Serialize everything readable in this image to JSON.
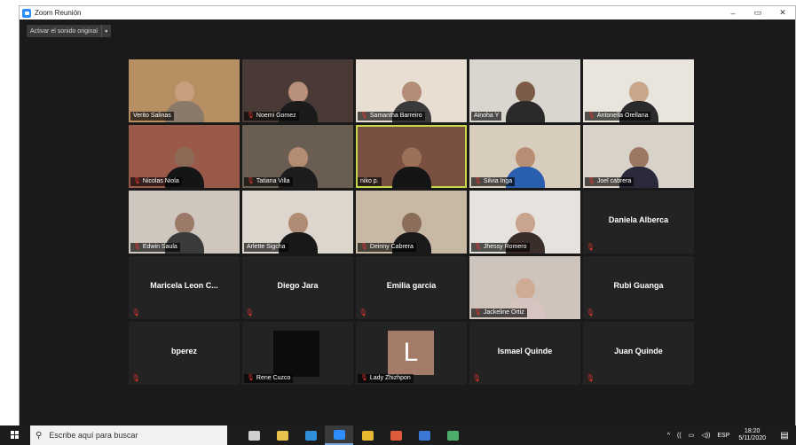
{
  "window": {
    "title": "Zoom Reunión",
    "controls": {
      "minimize": "–",
      "maximize": "▭",
      "close": "✕"
    }
  },
  "toolbar": {
    "original_audio_label": "Activar el sonido original",
    "dropdown_glyph": "▾"
  },
  "glyphs": {
    "mic_muted": "🎙"
  },
  "participants": [
    {
      "name": "Verito Salinas",
      "video": true,
      "muted": false,
      "skin": "#c9a07e",
      "shirt": "#8a7a6a",
      "bg": "#b88f63"
    },
    {
      "name": "Noemi Gomez",
      "video": true,
      "muted": true,
      "skin": "#b88f7a",
      "shirt": "#1b1b1b",
      "bg": "#4a3a36"
    },
    {
      "name": "Samantha Barreiro",
      "video": true,
      "muted": true,
      "skin": "#b38d76",
      "shirt": "#3a3a3a",
      "bg": "#e8ded2"
    },
    {
      "name": "Ainoha Y",
      "video": true,
      "muted": false,
      "skin": "#7c5a48",
      "shirt": "#2a2a2a",
      "bg": "#d9d6d0"
    },
    {
      "name": "Antonella Orellana",
      "video": true,
      "muted": true,
      "skin": "#c9a78a",
      "shirt": "#2b2b2b",
      "bg": "#e9e4dc"
    },
    {
      "name": "Nicolas Niola",
      "video": true,
      "muted": true,
      "skin": "#8c6a56",
      "shirt": "#151515",
      "bg": "#9a5a4a"
    },
    {
      "name": "Tatiana Villa",
      "video": true,
      "muted": true,
      "skin": "#b48c74",
      "shirt": "#1d1d1d",
      "bg": "#6a5e52"
    },
    {
      "name": "niko p.",
      "video": true,
      "muted": false,
      "active": true,
      "skin": "#9b7058",
      "shirt": "#151515",
      "bg": "#7a5040"
    },
    {
      "name": "Silvia Inga",
      "video": true,
      "muted": true,
      "skin": "#b98d74",
      "shirt": "#2a5fb0",
      "bg": "#d8ccbd"
    },
    {
      "name": "Joel cabrera",
      "video": true,
      "muted": true,
      "skin": "#9c7862",
      "shirt": "#2a2a3a",
      "bg": "#d9d2c8"
    },
    {
      "name": "Edwin Saula",
      "video": true,
      "muted": true,
      "skin": "#9a7a66",
      "shirt": "#3a3a3a",
      "bg": "#cfc7bd"
    },
    {
      "name": "Arlette Sigcha",
      "video": true,
      "muted": false,
      "skin": "#b08b74",
      "shirt": "#181818",
      "bg": "#ddd6cc"
    },
    {
      "name": "Deinny Cabrera",
      "video": true,
      "muted": true,
      "skin": "#8c6c5a",
      "shirt": "#1a1a1a",
      "bg": "#c8b9a4"
    },
    {
      "name": "Jhessy Romero",
      "video": true,
      "muted": true,
      "skin": "#c9a48e",
      "shirt": "#3a2d2a",
      "bg": "#e6e2de"
    },
    {
      "name": "Daniela Alberca",
      "video": false,
      "muted": true
    },
    {
      "name": "Maricela Leon C...",
      "video": false,
      "muted": true
    },
    {
      "name": "Diego Jara",
      "video": false,
      "muted": true
    },
    {
      "name": "Emilia garcia",
      "video": false,
      "muted": true
    },
    {
      "name": "Jackeline Ortiz",
      "video": true,
      "muted": true,
      "skin": "#d0ab94",
      "shirt": "#d6c4c0",
      "bg": "#cfc4bb"
    },
    {
      "name": "Rubi Guanga",
      "video": false,
      "muted": true
    },
    {
      "name": "bperez",
      "video": false,
      "muted": true
    },
    {
      "name": "Rene Cuzco",
      "video": false,
      "muted": true,
      "thumb": "black"
    },
    {
      "name": "Lady Zhizhpon",
      "video": false,
      "muted": true,
      "thumb": "letter",
      "letter": "L"
    },
    {
      "name": "Ismael Quinde",
      "video": false,
      "muted": true
    },
    {
      "name": "Juan Quinde",
      "video": false,
      "muted": true
    }
  ],
  "taskbar": {
    "search_placeholder": "Escribe aquí para buscar",
    "search_glyph": "⚲",
    "apps": [
      {
        "icon": "task-view-icon",
        "color": "#d0d0d0"
      },
      {
        "icon": "store-icon",
        "color": "#e8c24a"
      },
      {
        "icon": "edge-icon",
        "color": "#2f8fd8"
      },
      {
        "icon": "zoom-icon",
        "color": "#2d8cff",
        "active": true
      },
      {
        "icon": "file-explorer-icon",
        "color": "#e8b830"
      },
      {
        "icon": "chrome-icon",
        "color": "#de5a3a"
      },
      {
        "icon": "mail-icon",
        "color": "#3a78d6"
      },
      {
        "icon": "app-icon",
        "color": "#4cae6a"
      }
    ],
    "tray": {
      "chevron": "^",
      "network": "((",
      "battery": "▭",
      "volume": "◁))",
      "language": "ESP",
      "time": "18:20",
      "date": "5/11/2020",
      "notification_glyph": "▤"
    }
  }
}
